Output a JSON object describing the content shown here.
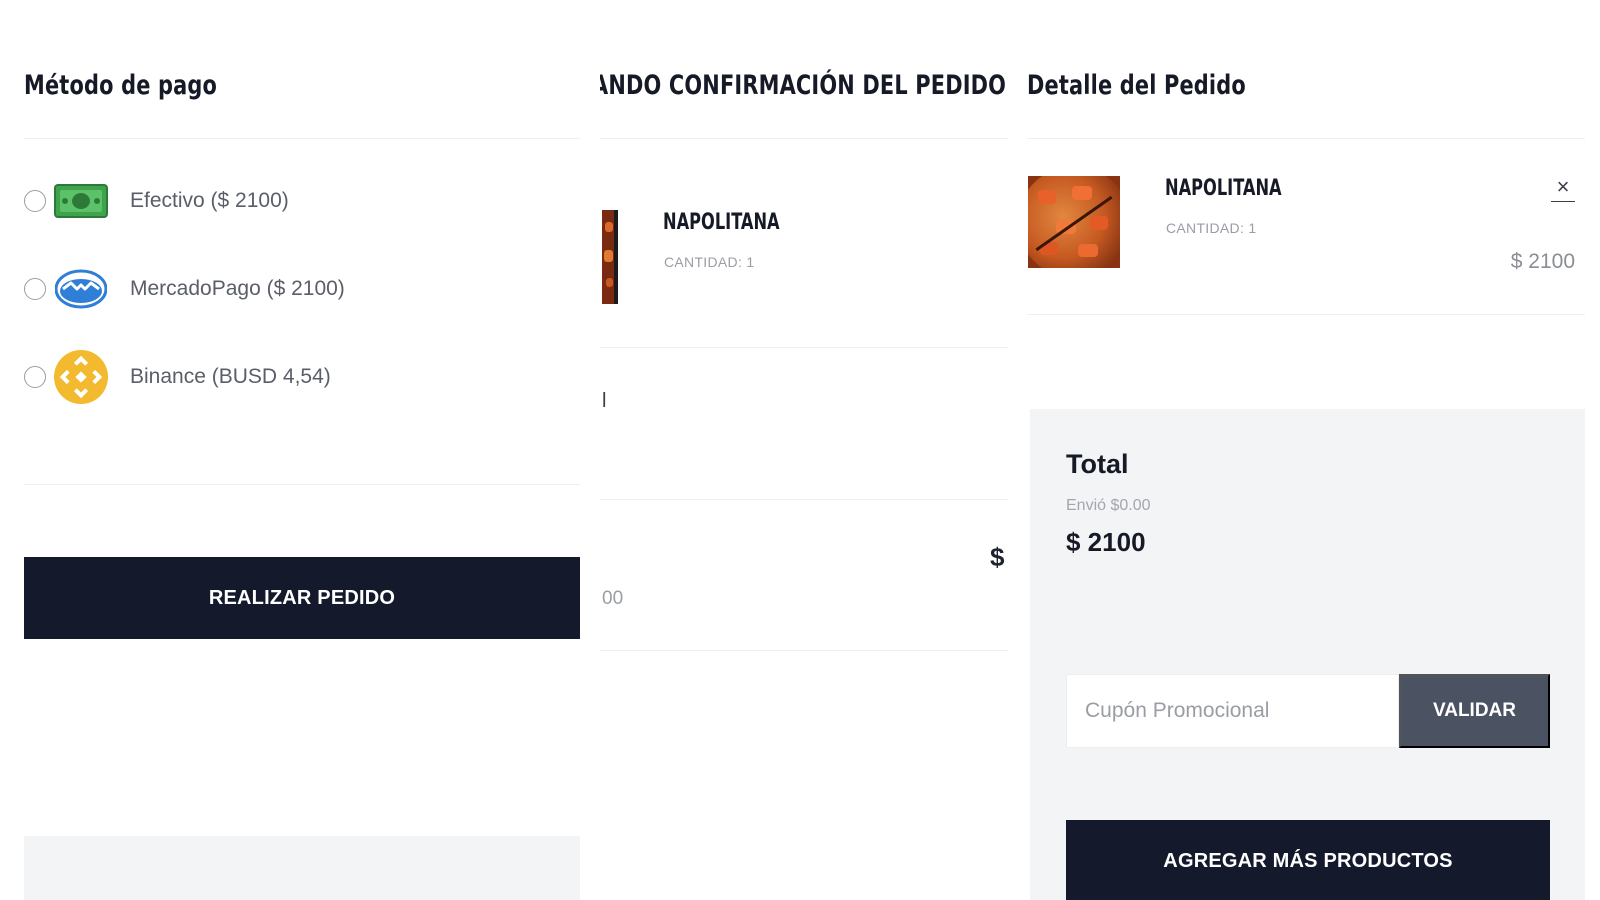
{
  "payment": {
    "title": "Método de pago",
    "options": [
      {
        "label": "Efectivo ($ 2100)",
        "icon": "cash-icon"
      },
      {
        "label": "MercadoPago ($ 2100)",
        "icon": "mercadopago-icon"
      },
      {
        "label": "Binance (BUSD 4,54)",
        "icon": "binance-icon"
      }
    ],
    "submit_label": "REALIZAR PEDIDO"
  },
  "confirmation": {
    "title": "ANDO CONFIRMACIÓN DEL PEDIDO",
    "item_name": "NAPOLITANA",
    "item_qty": "CANTIDAD: 1",
    "fragment_text": "l",
    "fragment_currency": "$",
    "fragment_amount": "00"
  },
  "order": {
    "title": "Detalle del Pedido",
    "item": {
      "name": "NAPOLITANA",
      "qty": "CANTIDAD: 1",
      "price": "$ 2100",
      "remove": "×"
    },
    "total_label": "Total",
    "shipping": "Envió $0.00",
    "total_value": "$ 2100",
    "coupon_placeholder": "Cupón Promocional",
    "validate_label": "VALIDAR",
    "add_more_label": "AGREGAR MÁS PRODUCTOS"
  },
  "colors": {
    "dark_button": "#141a2b",
    "validate_button": "#4b5363",
    "summary_bg": "#f3f4f6",
    "binance_yellow": "#f3ba2f",
    "cash_green": "#3fa34d",
    "mercadopago_blue": "#2f7fd6"
  }
}
